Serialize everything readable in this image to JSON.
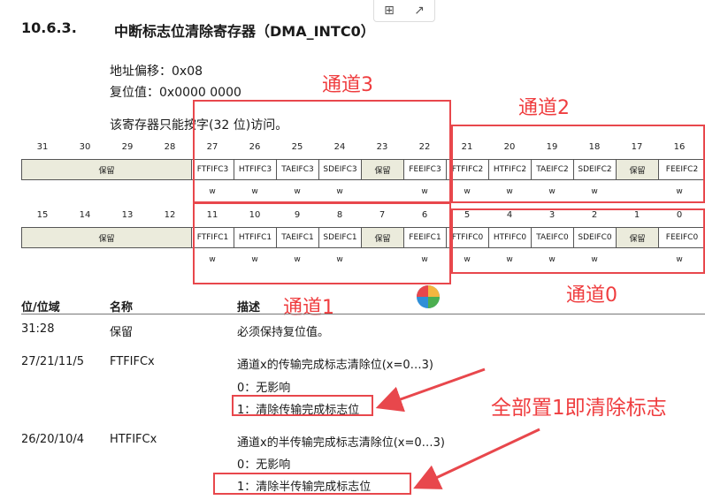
{
  "section": {
    "number": "10.6.3.",
    "title": "中断标志位清除寄存器（DMA_INTC0）"
  },
  "meta": {
    "offset": "地址偏移：0x08",
    "reset": "复位值：0x0000 0000",
    "access": "该寄存器只能按字(32 位)访问。"
  },
  "upper_bits": [
    "31",
    "30",
    "29",
    "28",
    "27",
    "26",
    "25",
    "24",
    "23",
    "22",
    "21",
    "20",
    "19",
    "18",
    "17",
    "16"
  ],
  "upper_cells": [
    "保留",
    "FTFIFC3",
    "HTFIFC3",
    "TAEIFC3",
    "SDEIFC3",
    "保留",
    "FEEIFC3",
    "FTFIFC2",
    "HTFIFC2",
    "TAEIFC2",
    "SDEIFC2",
    "保留",
    "FEEIFC2"
  ],
  "lower_bits": [
    "15",
    "14",
    "13",
    "12",
    "11",
    "10",
    "9",
    "8",
    "7",
    "6",
    "5",
    "4",
    "3",
    "2",
    "1",
    "0"
  ],
  "lower_cells": [
    "保留",
    "FTFIFC1",
    "HTFIFC1",
    "TAEIFC1",
    "SDEIFC1",
    "保留",
    "FEEIFC1",
    "FTFIFC0",
    "HTFIFC0",
    "TAEIFC0",
    "SDEIFC0",
    "保留",
    "FEEIFC0"
  ],
  "access_mark": "w",
  "annotations": {
    "ch3": "通道3",
    "ch2": "通道2",
    "ch1": "通道1",
    "ch0": "通道0",
    "note": "全部置1即清除标志"
  },
  "table": {
    "headers": [
      "位/位域",
      "名称",
      "描述"
    ],
    "rows": [
      {
        "bits": "31:28",
        "name": "保留",
        "desc": [
          "必须保持复位值。"
        ]
      },
      {
        "bits": "27/21/11/5",
        "name": "FTFIFCx",
        "desc": [
          "通道x的传输完成标志清除位(x=0…3)",
          "0：无影响",
          "1：清除传输完成标志位"
        ]
      },
      {
        "bits": "26/20/10/4",
        "name": "HTFIFCx",
        "desc": [
          "通道x的半传输完成标志清除位(x=0…3)",
          "0：无影响",
          "1：清除半传输完成标志位"
        ]
      }
    ]
  },
  "toolbar": {
    "grid_icon": "⊞",
    "share_icon": "↗"
  },
  "colors": {
    "annotation_red": "#e8474c",
    "reserved_fill": "#ebebdc"
  }
}
